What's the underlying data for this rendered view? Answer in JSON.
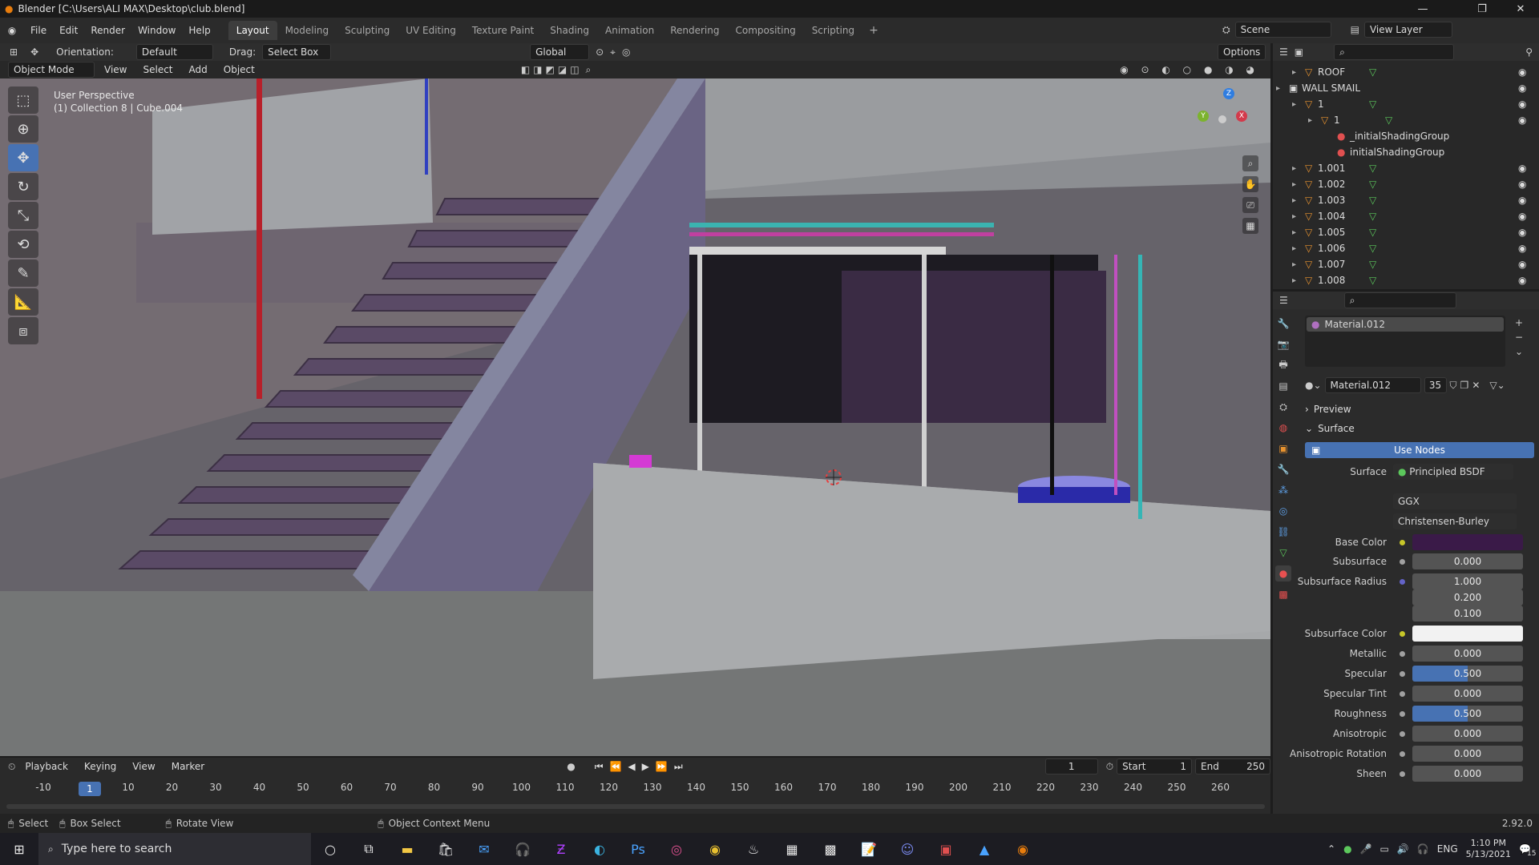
{
  "window": {
    "title": "Blender [C:\\Users\\ALI MAX\\Desktop\\club.blend]"
  },
  "menu": [
    "File",
    "Edit",
    "Render",
    "Window",
    "Help"
  ],
  "workspaces": [
    "Layout",
    "Modeling",
    "Sculpting",
    "UV Editing",
    "Texture Paint",
    "Shading",
    "Animation",
    "Rendering",
    "Compositing",
    "Scripting"
  ],
  "scene": {
    "label": "Scene",
    "view_layer": "View Layer"
  },
  "header": {
    "orientation_label": "Orientation:",
    "orientation_value": "Default",
    "drag_label": "Drag:",
    "drag_value": "Select Box",
    "transform_space": "Global",
    "options": "Options"
  },
  "viewport_header": {
    "mode": "Object Mode",
    "menus": [
      "View",
      "Select",
      "Add",
      "Object"
    ]
  },
  "viewport": {
    "perspective": "User Perspective",
    "selection": "(1) Collection 8 | Cube.004"
  },
  "gizmo": {
    "x": "X",
    "y": "Y",
    "z": "Z"
  },
  "outliner": {
    "items": [
      {
        "name": "ROOF",
        "indent": 1
      },
      {
        "name": "WALL SMAIL",
        "indent": 0
      },
      {
        "name": "1",
        "indent": 1
      },
      {
        "name": "1",
        "indent": 2
      },
      {
        "name": "_initialShadingGroup",
        "indent": 3
      },
      {
        "name": "initialShadingGroup",
        "indent": 3
      },
      {
        "name": "1.001",
        "indent": 1
      },
      {
        "name": "1.002",
        "indent": 1
      },
      {
        "name": "1.003",
        "indent": 1
      },
      {
        "name": "1.004",
        "indent": 1
      },
      {
        "name": "1.005",
        "indent": 1
      },
      {
        "name": "1.006",
        "indent": 1
      },
      {
        "name": "1.007",
        "indent": 1
      },
      {
        "name": "1.008",
        "indent": 1
      }
    ]
  },
  "properties": {
    "material_slot": "Material.012",
    "material_name": "Material.012",
    "users": "35",
    "preview_label": "Preview",
    "surface_label": "Surface",
    "use_nodes": "Use Nodes",
    "surface_field_label": "Surface",
    "surface_shader": "Principled BSDF",
    "distribution": "GGX",
    "subsurface_method": "Christensen-Burley",
    "base_color_label": "Base Color",
    "base_color": "#3a1a48",
    "subsurface_color": "#f2f2f2",
    "rows": [
      {
        "label": "Subsurface",
        "value": "0.000",
        "bar": 0
      },
      {
        "label": "Subsurface Radius",
        "value": "1.000",
        "bar": 0
      },
      {
        "label": "",
        "value": "0.200",
        "bar": 0
      },
      {
        "label": "",
        "value": "0.100",
        "bar": 0
      },
      {
        "label": "Subsurface Color",
        "value": "",
        "bar": 0
      },
      {
        "label": "Metallic",
        "value": "0.000",
        "bar": 0
      },
      {
        "label": "Specular",
        "value": "0.500",
        "bar": 0.5
      },
      {
        "label": "Specular Tint",
        "value": "0.000",
        "bar": 0
      },
      {
        "label": "Roughness",
        "value": "0.500",
        "bar": 0.5
      },
      {
        "label": "Anisotropic",
        "value": "0.000",
        "bar": 0
      },
      {
        "label": "Anisotropic Rotation",
        "value": "0.000",
        "bar": 0
      },
      {
        "label": "Sheen",
        "value": "0.000",
        "bar": 0
      }
    ]
  },
  "timeline": {
    "menus": [
      "Playback",
      "Keying",
      "View",
      "Marker"
    ],
    "current_frame": "1",
    "start_label": "Start",
    "start": "1",
    "end_label": "End",
    "end": "250",
    "ticks": [
      "-10",
      "1",
      "10",
      "20",
      "30",
      "40",
      "50",
      "60",
      "70",
      "80",
      "90",
      "100",
      "110",
      "120",
      "130",
      "140",
      "150",
      "160",
      "170",
      "180",
      "190",
      "200",
      "210",
      "220",
      "230",
      "240",
      "250",
      "260"
    ]
  },
  "status": {
    "select": "Select",
    "box_select": "Box Select",
    "rotate": "Rotate View",
    "context": "Object Context Menu",
    "version": "2.92.0"
  },
  "taskbar": {
    "search_placeholder": "Type here to search",
    "lang": "ENG",
    "time": "1:10 PM",
    "date": "5/13/2021",
    "notif": "15"
  }
}
